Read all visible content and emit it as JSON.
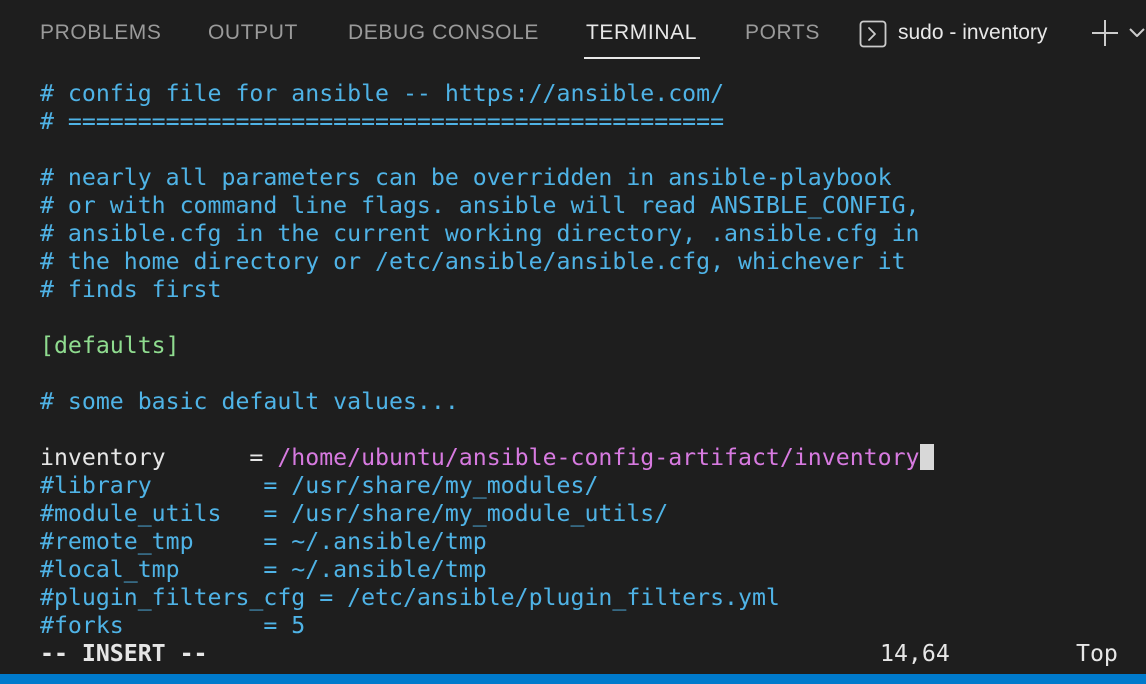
{
  "tabs": [
    {
      "label": "PROBLEMS",
      "active": false
    },
    {
      "label": "OUTPUT",
      "active": false
    },
    {
      "label": "DEBUG CONSOLE",
      "active": false
    },
    {
      "label": "TERMINAL",
      "active": true
    },
    {
      "label": "PORTS",
      "active": false
    }
  ],
  "terminal_instance": {
    "icon": "terminal-icon",
    "label": "sudo - inventory"
  },
  "actions": {
    "new_terminal_icon": "plus-icon",
    "dropdown_icon": "chevron-down-icon"
  },
  "editor": {
    "lines": {
      "l1": "# config file for ansible -- https://ansible.com/",
      "l2": "# ===============================================",
      "l4": "# nearly all parameters can be overridden in ansible-playbook",
      "l5": "# or with command line flags. ansible will read ANSIBLE_CONFIG,",
      "l6": "# ansible.cfg in the current working directory, .ansible.cfg in",
      "l7": "# the home directory or /etc/ansible/ansible.cfg, whichever it",
      "l8": "# finds first",
      "l10": "[defaults]",
      "l12": "# some basic default values...",
      "inventory_key": "inventory      ",
      "inventory_eq": "= ",
      "inventory_value": "/home/ubuntu/ansible-config-artifact/inventory",
      "l15": "#library        = /usr/share/my_modules/",
      "l16": "#module_utils   = /usr/share/my_module_utils/",
      "l17": "#remote_tmp     = ~/.ansible/tmp",
      "l18": "#local_tmp      = ~/.ansible/tmp",
      "l19": "#plugin_filters_cfg = /etc/ansible/plugin_filters.yml",
      "l20": "#forks          = 5"
    },
    "mode": "-- INSERT --",
    "cursor_position": "14,64",
    "scroll_position": "Top"
  },
  "colors": {
    "background": "#1e1e1e",
    "comment": "#4fb3e6",
    "section": "#8fdc8f",
    "path": "#d77ae0",
    "statusbar": "#007acc"
  }
}
